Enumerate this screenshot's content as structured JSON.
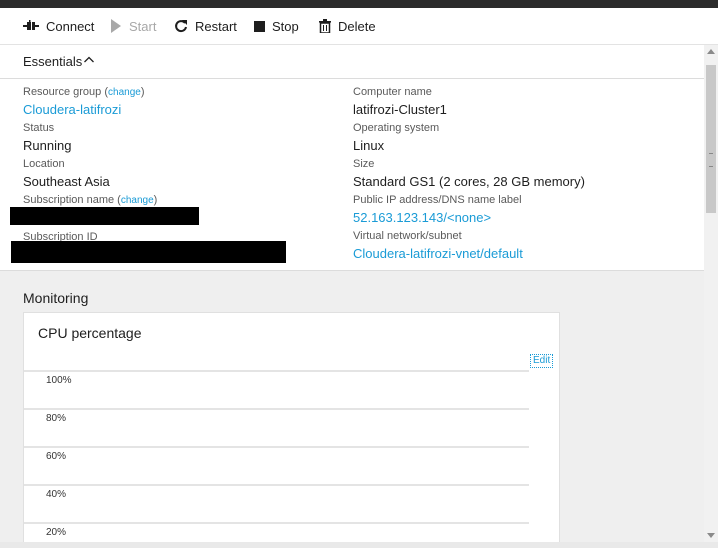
{
  "toolbar": {
    "connect": "Connect",
    "start": "Start",
    "restart": "Restart",
    "stop": "Stop",
    "delete": "Delete"
  },
  "essentials": {
    "title": "Essentials",
    "left": {
      "resource_group_label": "Resource group",
      "resource_group_change": "change",
      "resource_group_value": "Cloudera-latifrozi",
      "status_label": "Status",
      "status_value": "Running",
      "location_label": "Location",
      "location_value": "Southeast Asia",
      "subscription_name_label": "Subscription name",
      "subscription_name_change": "change",
      "subscription_id_label": "Subscription ID"
    },
    "right": {
      "computer_name_label": "Computer name",
      "computer_name_value": "latifrozi-Cluster1",
      "os_label": "Operating system",
      "os_value": "Linux",
      "size_label": "Size",
      "size_value": "Standard GS1 (2 cores, 28 GB memory)",
      "ip_label": "Public IP address/DNS name label",
      "ip_value": "52.163.123.143/<none>",
      "vnet_label": "Virtual network/subnet",
      "vnet_value": "Cloudera-latifrozi-vnet/default"
    }
  },
  "monitoring": {
    "title": "Monitoring",
    "card_title": "CPU percentage",
    "edit_label": "Edit"
  },
  "chart_data": {
    "type": "line",
    "title": "CPU percentage",
    "ytick_labels": [
      "100%",
      "80%",
      "60%",
      "40%",
      "20%"
    ],
    "ylim": [
      0,
      100
    ],
    "series": []
  },
  "colors": {
    "link": "#1a9bd6",
    "topbar": "#2b2b2b",
    "monitor_bg": "#efefef"
  }
}
